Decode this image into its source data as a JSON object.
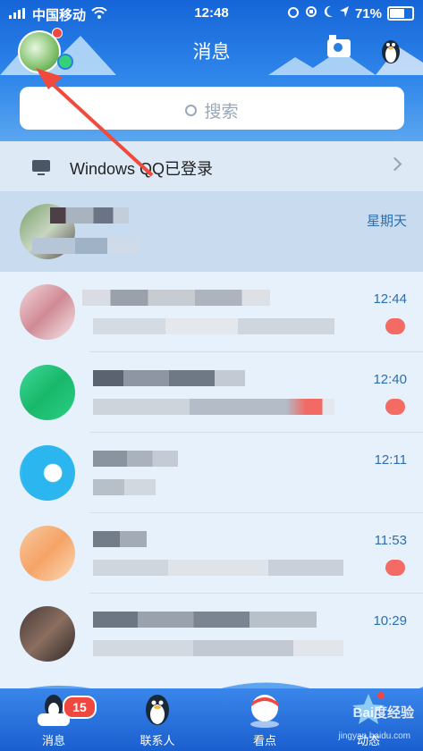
{
  "status_bar": {
    "carrier": "中国移动",
    "time": "12:48",
    "battery": "71%"
  },
  "nav": {
    "title": "消息"
  },
  "search": {
    "placeholder": "搜索"
  },
  "login_banner": {
    "text": "Windows QQ已登录"
  },
  "chats": [
    {
      "time": "星期天",
      "pinned": true
    },
    {
      "time": "12:44",
      "pinned": false
    },
    {
      "time": "12:40",
      "pinned": false
    },
    {
      "time": "12:11",
      "pinned": false
    },
    {
      "time": "11:53",
      "pinned": false
    },
    {
      "time": "10:29",
      "pinned": false
    }
  ],
  "tabs": [
    {
      "label": "消息",
      "badge": "15"
    },
    {
      "label": "联系人"
    },
    {
      "label": "看点"
    },
    {
      "label": "动态"
    }
  ],
  "colors": {
    "header_blue": "#2c7fe0",
    "accent_red": "#f0483e",
    "badge_red": "#f46b63"
  },
  "watermark": {
    "text": "Bai度经验",
    "url": "jingyan.baidu.com"
  }
}
